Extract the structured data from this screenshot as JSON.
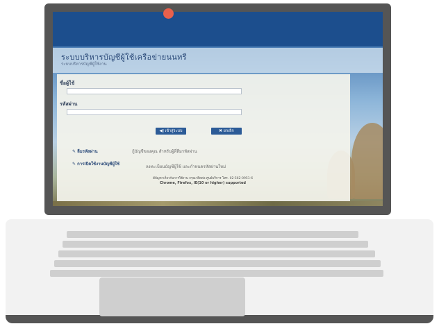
{
  "page": {
    "system_title": "ระบบบริหารบัญชีผู้ใช้เครือข่ายนนทรี",
    "system_subtitle": "ระบบบริหารบัญชีผู้ใช้งาน"
  },
  "login": {
    "username_label": "ชื่อผู้ใช้",
    "password_label": "รหัสผ่าน",
    "login_button": "◀] เข้าสู่ระบบ",
    "cancel_button": "✖ ยกเลิก"
  },
  "links": [
    {
      "label": "ลืมรหัสผ่าน",
      "description": "กู้บัญชีของคุณ สำหรับผู้ที่ลืมรหัสผ่าน"
    },
    {
      "label": "การเปิดใช้งานบัญชีผู้ใช้",
      "description": "ลงทะเบียนบัญชีผู้ใช้ และกำหนดรหัสผ่านใหม่"
    }
  ],
  "footer": {
    "line1": "มีปัญหาเกี่ยวกับการใช้งาน กรุณาติดต่อ ศูนย์บริการ โทร. 02-562-0951-6",
    "line2": "Chrome, Firefox, IE(10 or higher) supported"
  },
  "colors": {
    "bezel": "#555555",
    "header_band": "#1c4e8d",
    "button": "#2c5b97",
    "camera": "#e8604c"
  }
}
